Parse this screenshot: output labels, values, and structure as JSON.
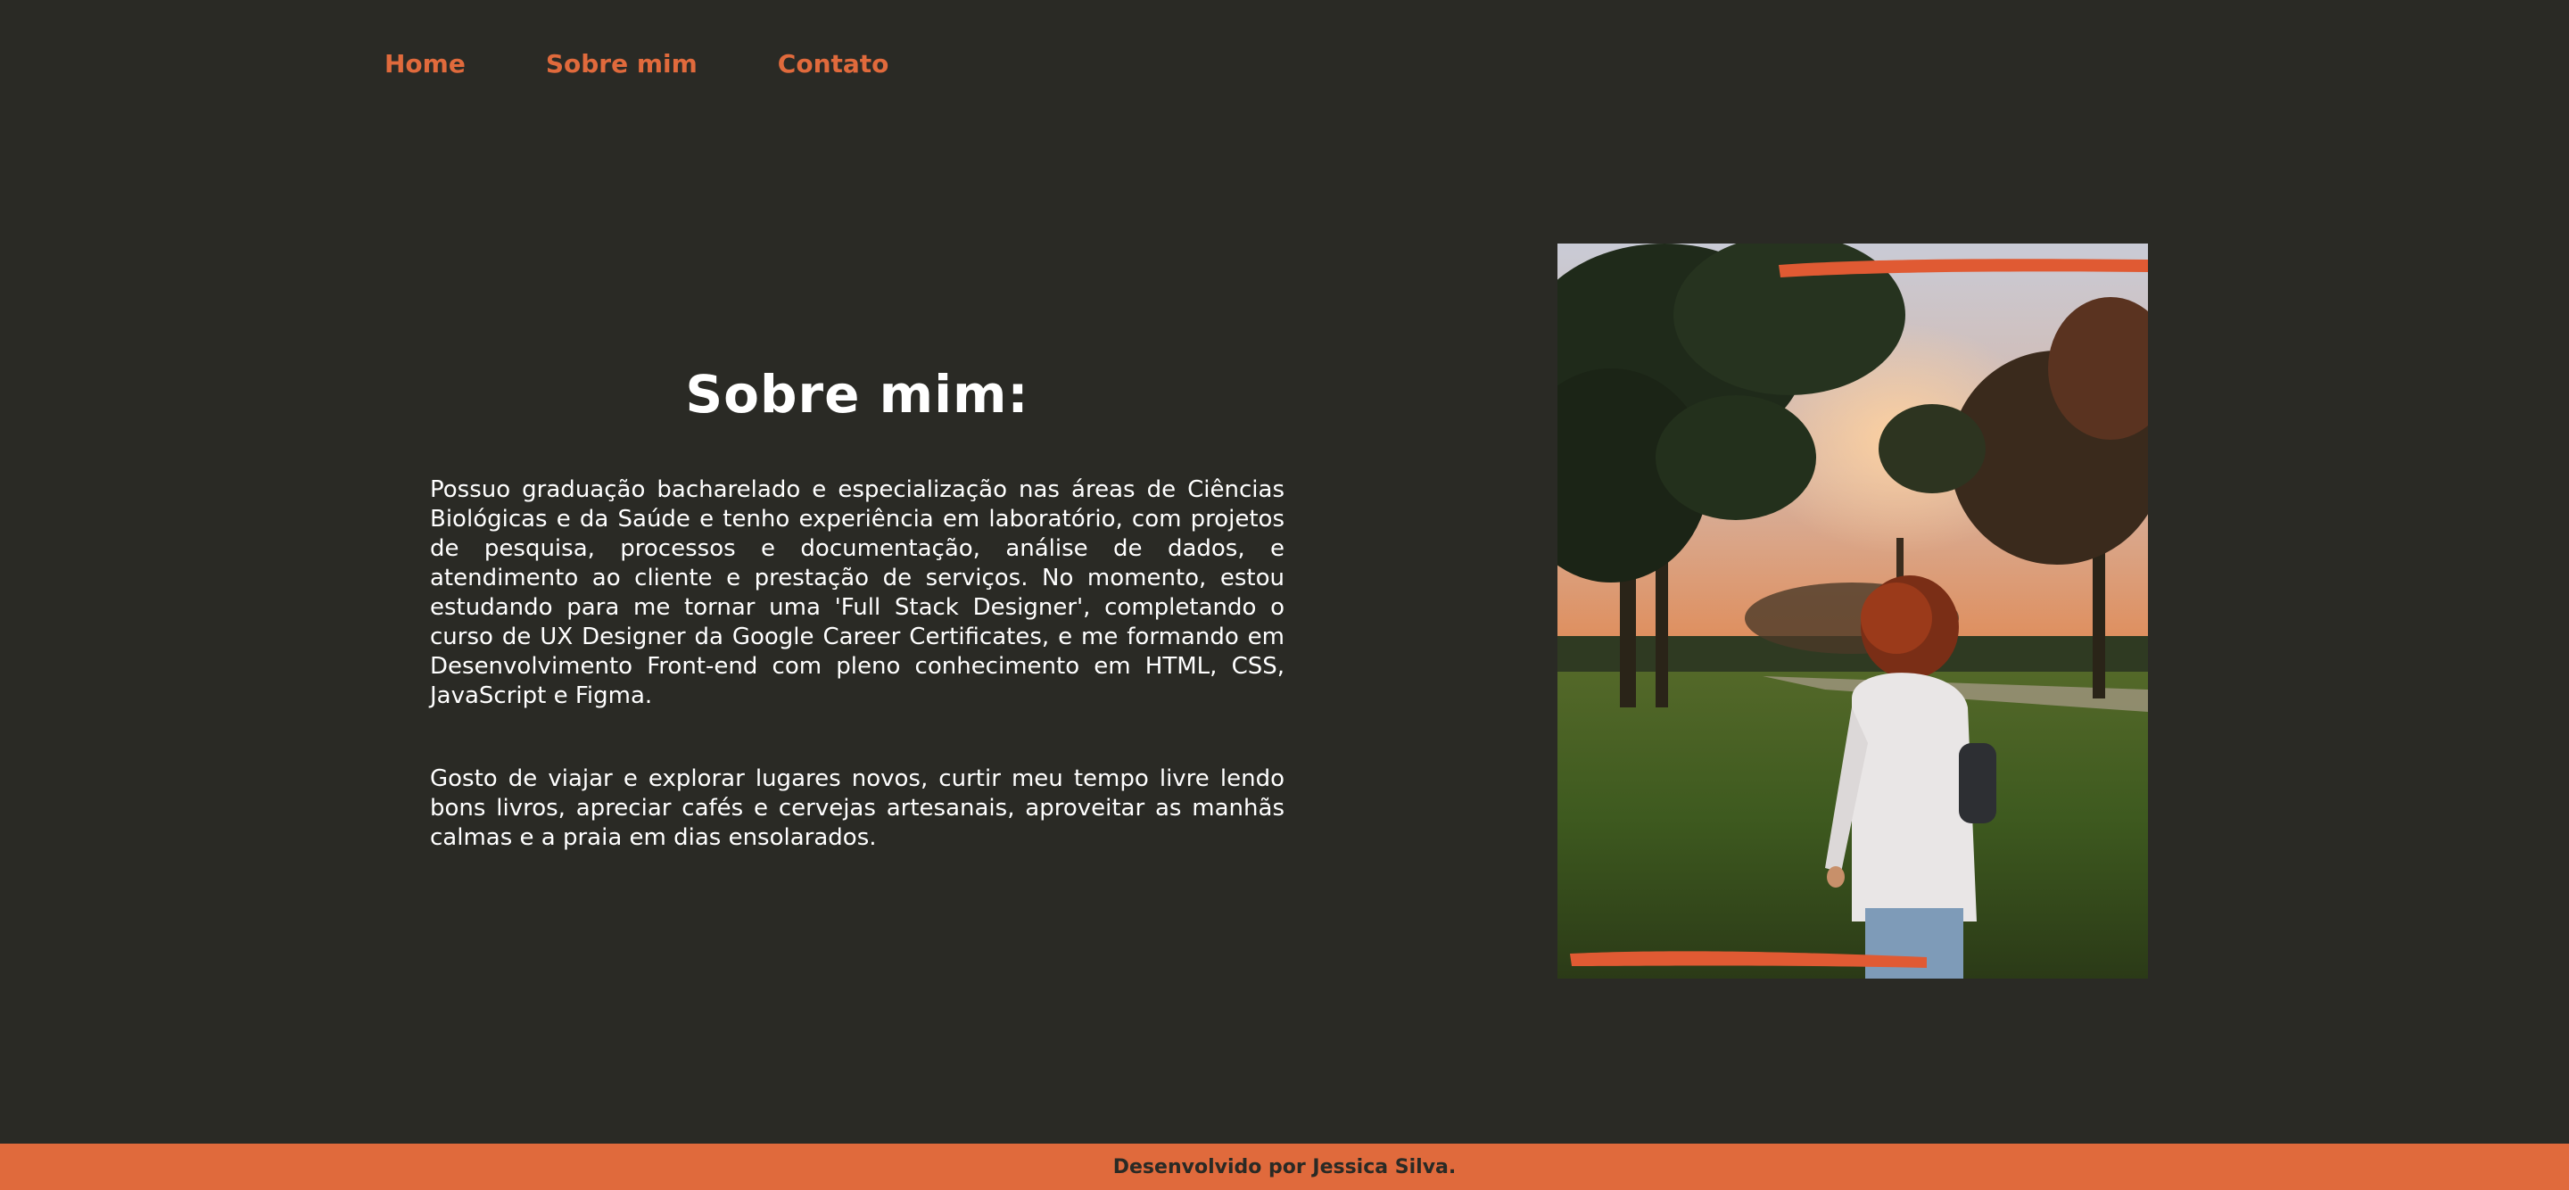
{
  "nav": {
    "items": [
      {
        "label": "Home"
      },
      {
        "label": "Sobre mim"
      },
      {
        "label": "Contato"
      }
    ]
  },
  "about": {
    "title": "Sobre mim:",
    "paragraphs": [
      "Possuo graduação bacharelado e especialização nas áreas de Ciências Biológicas e da Saúde e tenho experiência em laboratório, com projetos de pesquisa, processos e documentação, análise de dados, e atendimento ao cliente e prestação de serviços. No momento, estou estudando para me tornar uma 'Full Stack Designer', completando o curso de UX Designer da Google Career Certificates, e me formando em Desenvolvimento Front-end com pleno conhecimento em HTML, CSS, JavaScript e Figma.",
      "Gosto de viajar e explorar lugares novos, curtir meu tempo livre lendo bons livros, apreciar cafés e cervejas artesanais, aproveitar as manhãs calmas e a praia em dias ensolarados."
    ]
  },
  "photo": {
    "subject": "woman-in-park-at-sunset"
  },
  "footer": {
    "text": "Desenvolvido por Jessica Silva."
  },
  "colors": {
    "background": "#2a2a25",
    "accent": "#e06a3c",
    "text": "#ffffff"
  }
}
